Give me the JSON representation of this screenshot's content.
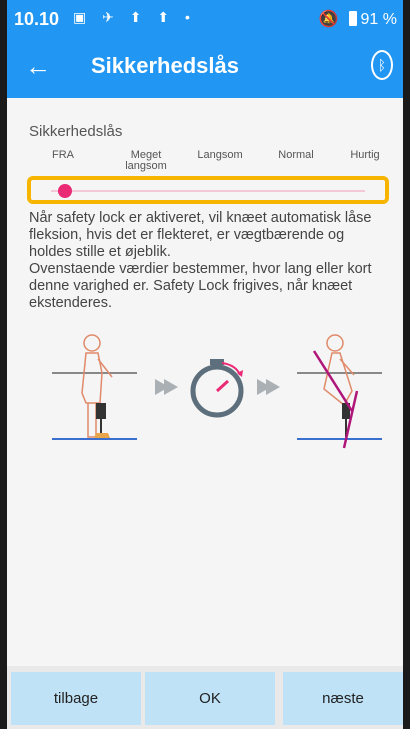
{
  "status": {
    "time": "10.10",
    "battery": "91 %"
  },
  "appbar": {
    "title": "Sikkerhedslås"
  },
  "section": {
    "title": "Sikkerhedslås"
  },
  "slider": {
    "options": [
      "FRA",
      "Meget langsom",
      "Langsom",
      "Normal",
      "Hurtig"
    ],
    "selected": "FRA",
    "value_fraction": 0.0
  },
  "description": "Når safety lock er aktiveret, vil knæet automatisk låse fleksion, hvis det er flekteret, er vægtbærende og holdes stille et øjeblik.\nOvenstaende værdier bestemmer, hvor lang eller kort denne varighed er. Safety Lock frigives, når knæet ekstenderes.",
  "buttons": {
    "back": "tilbage",
    "ok": "OK",
    "next": "næste"
  },
  "colors": {
    "accent": "#2196f3",
    "highlight": "#f7b500",
    "thumb": "#ea2a74",
    "button_bg": "#bfe2f7"
  }
}
